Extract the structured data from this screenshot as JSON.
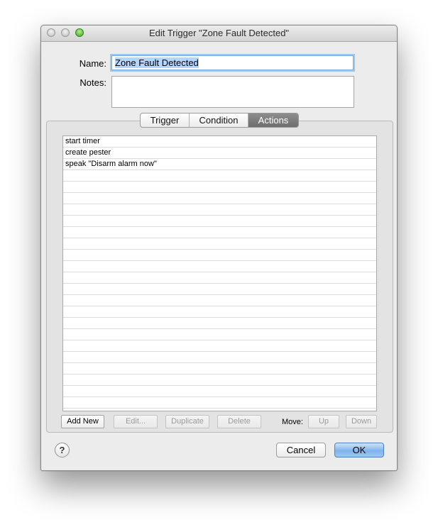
{
  "window": {
    "title": "Edit Trigger \"Zone Fault Detected\""
  },
  "form": {
    "name_label": "Name:",
    "name_value": "Zone Fault Detected",
    "notes_label": "Notes:",
    "notes_value": ""
  },
  "tabs": [
    {
      "label": "Trigger",
      "active": false
    },
    {
      "label": "Condition",
      "active": false
    },
    {
      "label": "Actions",
      "active": true
    }
  ],
  "actions_list": [
    "start timer",
    "create pester",
    "speak \"Disarm alarm now\"",
    "",
    "",
    "",
    "",
    "",
    "",
    "",
    "",
    "",
    "",
    "",
    "",
    "",
    "",
    "",
    "",
    "",
    "",
    "",
    "",
    "",
    ""
  ],
  "list_buttons": {
    "add_new": "Add New",
    "edit": "Edit...",
    "duplicate": "Duplicate",
    "delete": "Delete",
    "move_label": "Move:",
    "up": "Up",
    "down": "Down"
  },
  "footer": {
    "help": "?",
    "cancel": "Cancel",
    "ok": "OK"
  }
}
